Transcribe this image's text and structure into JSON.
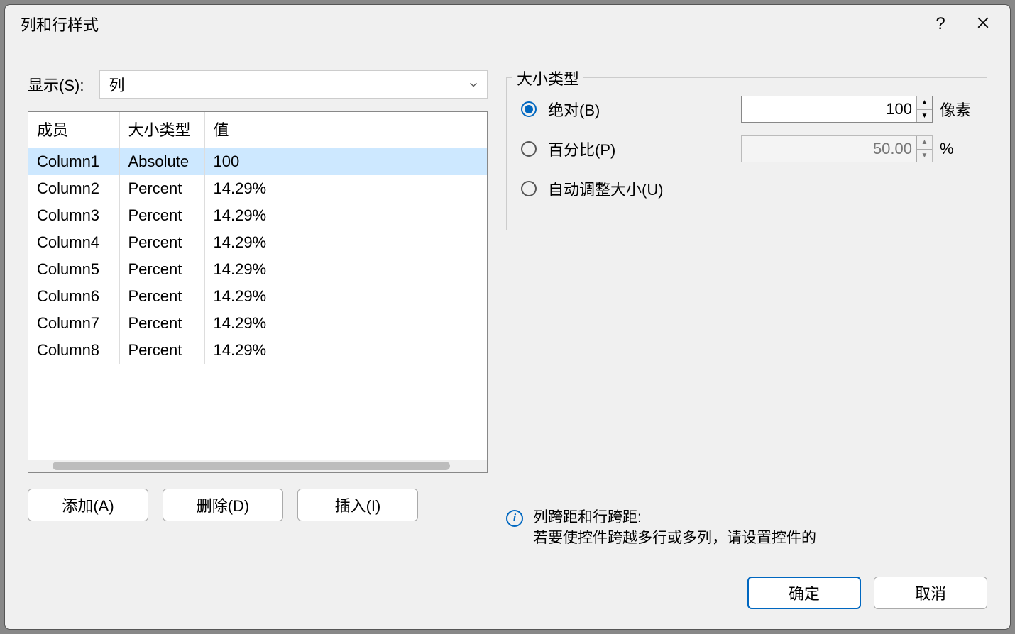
{
  "title": "列和行样式",
  "show": {
    "label": "显示(S):",
    "value": "列"
  },
  "grid": {
    "headers": {
      "member": "成员",
      "type": "大小类型",
      "value": "值"
    },
    "rows": [
      {
        "member": "Column1",
        "type": "Absolute",
        "value": "100",
        "selected": true
      },
      {
        "member": "Column2",
        "type": "Percent",
        "value": "14.29%"
      },
      {
        "member": "Column3",
        "type": "Percent",
        "value": "14.29%"
      },
      {
        "member": "Column4",
        "type": "Percent",
        "value": "14.29%"
      },
      {
        "member": "Column5",
        "type": "Percent",
        "value": "14.29%"
      },
      {
        "member": "Column6",
        "type": "Percent",
        "value": "14.29%"
      },
      {
        "member": "Column7",
        "type": "Percent",
        "value": "14.29%"
      },
      {
        "member": "Column8",
        "type": "Percent",
        "value": "14.29%"
      }
    ]
  },
  "buttons": {
    "add": "添加(A)",
    "delete": "删除(D)",
    "insert": "插入(I)"
  },
  "sizetype": {
    "title": "大小类型",
    "absolute": {
      "label": "绝对(B)",
      "value": "100",
      "unit": "像素"
    },
    "percent": {
      "label": "百分比(P)",
      "value": "50.00",
      "unit": "%"
    },
    "auto": {
      "label": "自动调整大小(U)"
    }
  },
  "info": {
    "title": "列跨距和行跨距:",
    "body": "若要使控件跨越多行或多列，请设置控件的"
  },
  "footer": {
    "ok": "确定",
    "cancel": "取消"
  }
}
